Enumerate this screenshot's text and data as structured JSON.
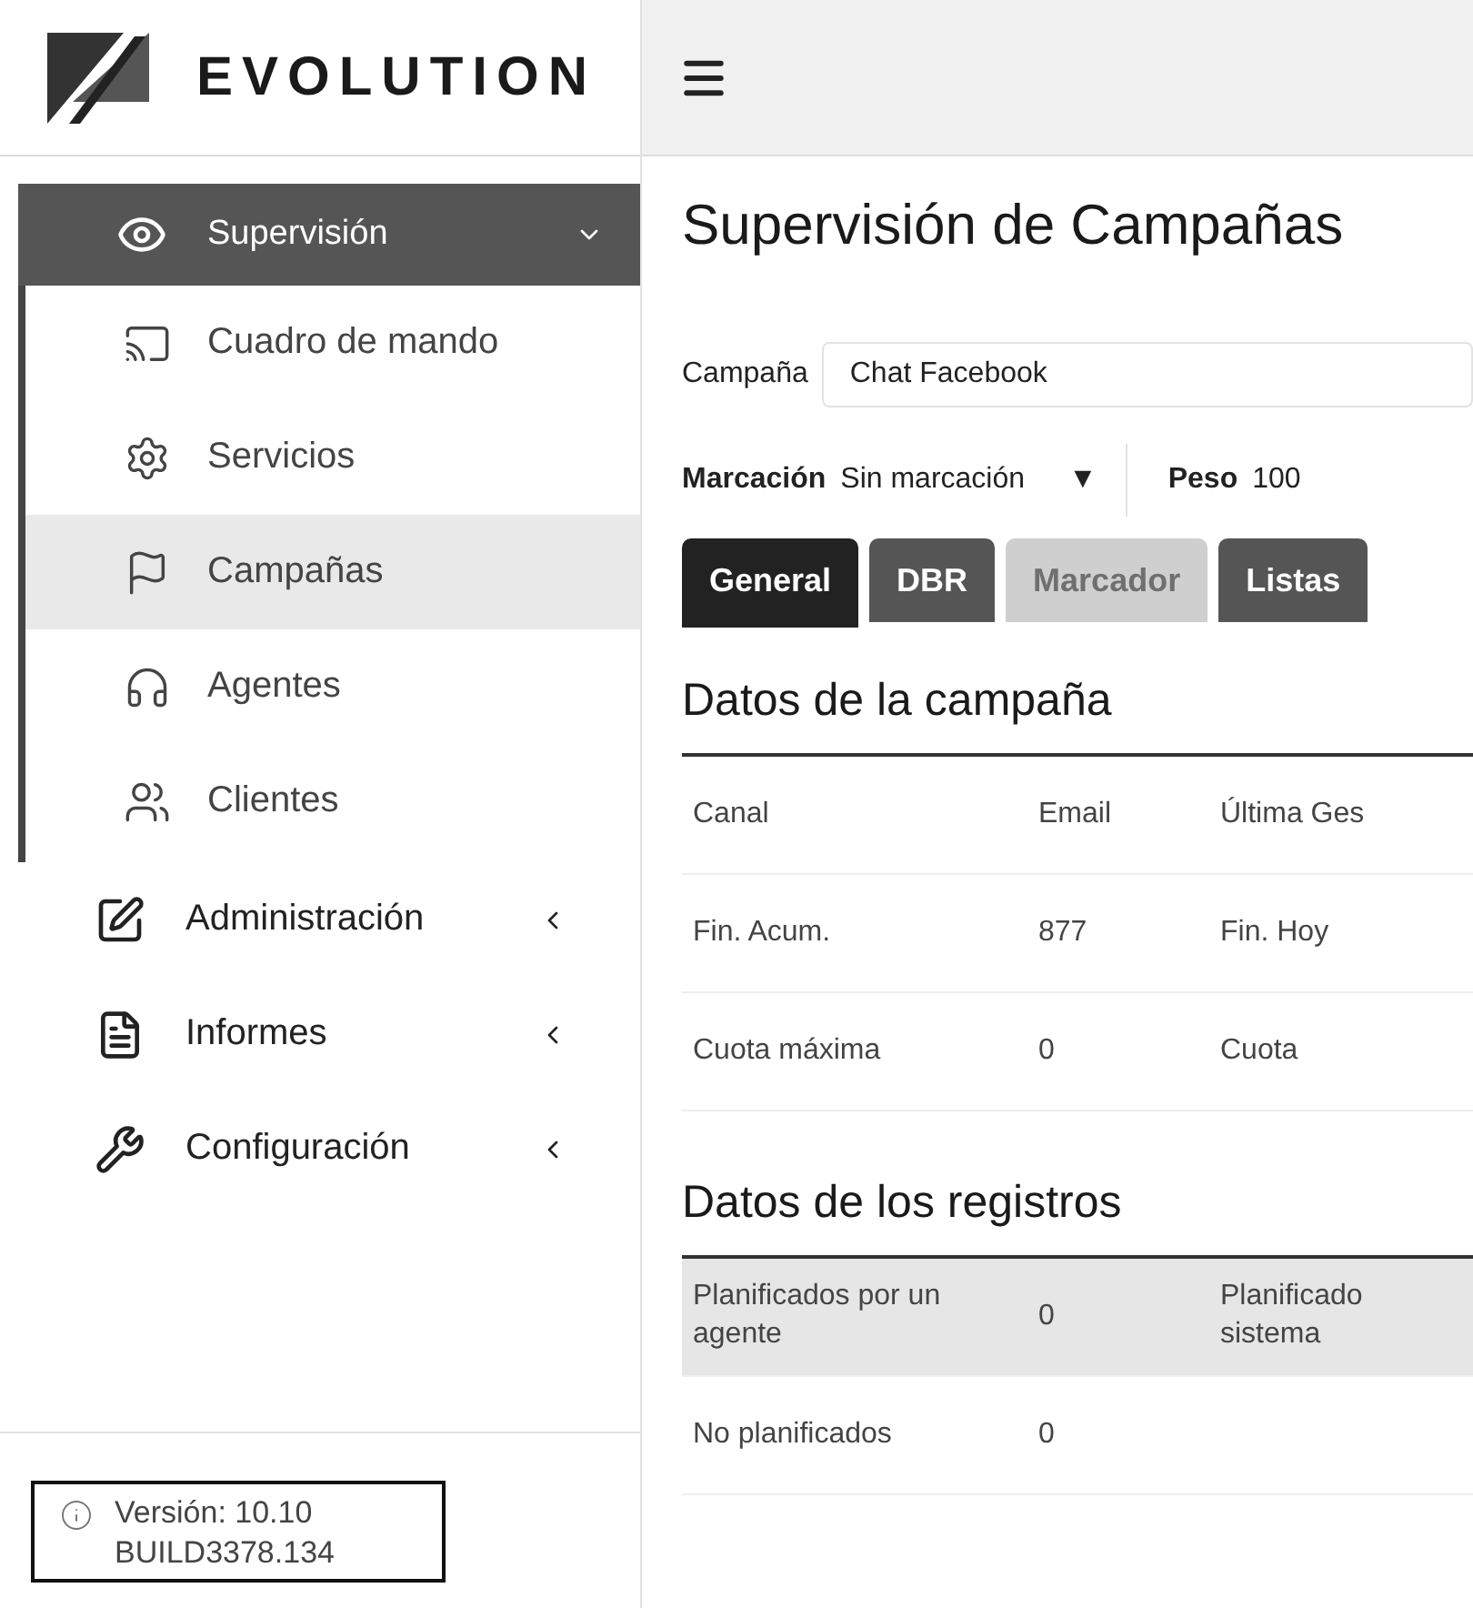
{
  "logo": {
    "text": "EVOLUTION"
  },
  "sidebar": {
    "items": [
      {
        "label": "Supervisión",
        "expanded": true,
        "selected": true,
        "children": [
          {
            "label": "Cuadro de mando",
            "selected": false
          },
          {
            "label": "Servicios",
            "selected": false
          },
          {
            "label": "Campañas",
            "selected": true
          },
          {
            "label": "Agentes",
            "selected": false
          },
          {
            "label": "Clientes",
            "selected": false
          }
        ]
      },
      {
        "label": "Administración",
        "expanded": false,
        "selected": false
      },
      {
        "label": "Informes",
        "expanded": false,
        "selected": false
      },
      {
        "label": "Configuración",
        "expanded": false,
        "selected": false
      }
    ],
    "version": {
      "line_1": "Versión: 10.10",
      "line_2": "BUILD3378.134"
    }
  },
  "page": {
    "title": "Supervisión de Campañas",
    "campaign": {
      "label": "Campaña",
      "value": "Chat Facebook"
    },
    "dialing": {
      "label": "Marcación",
      "value": "Sin marcación",
      "caret": "▼"
    },
    "weight": {
      "label": "Peso",
      "value": "100"
    },
    "tabs": [
      {
        "label": "General",
        "selected": true,
        "disabled": false
      },
      {
        "label": "DBR",
        "selected": false,
        "disabled": false
      },
      {
        "label": "Marcador",
        "selected": false,
        "disabled": true
      },
      {
        "label": "Listas",
        "selected": false,
        "disabled": false
      }
    ],
    "sections": [
      {
        "title": "Datos de la campaña",
        "rows": [
          {
            "highlighted": false,
            "cells": [
              "Canal",
              "Email",
              "Última Ges"
            ]
          },
          {
            "highlighted": false,
            "cells": [
              "Fin. Acum.",
              "877",
              "Fin. Hoy"
            ]
          },
          {
            "highlighted": false,
            "cells": [
              "Cuota máxima",
              "0",
              "Cuota"
            ]
          }
        ]
      },
      {
        "title": "Datos de los registros",
        "rows": [
          {
            "highlighted": true,
            "cells": [
              "Planificados por un agente",
              "0",
              "Planificado sistema"
            ]
          },
          {
            "highlighted": false,
            "cells": [
              "No planificados",
              "0"
            ]
          }
        ]
      }
    ]
  }
}
